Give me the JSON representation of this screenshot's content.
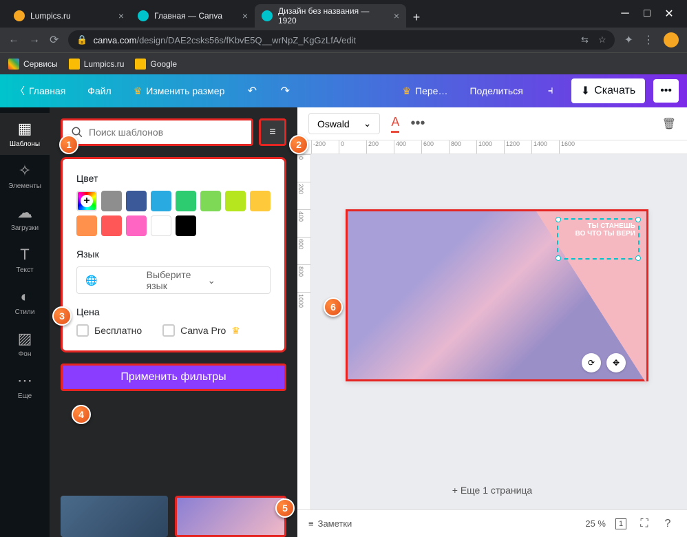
{
  "browser": {
    "tabs": [
      {
        "title": "Lumpics.ru",
        "active": false
      },
      {
        "title": "Главная — Canva",
        "active": false
      },
      {
        "title": "Дизайн без названия — 1920",
        "active": true
      }
    ],
    "url_prefix": "canva.com",
    "url_rest": "/design/DAE2csks56s/fKbvE5Q__wrNpZ_KgGzLfA/edit",
    "bookmarks": [
      "Сервисы",
      "Lumpics.ru",
      "Google"
    ]
  },
  "header": {
    "home": "Главная",
    "file": "Файл",
    "resize": "Изменить размер",
    "translate": "Пере…",
    "share": "Поделиться",
    "download": "Скачать"
  },
  "sidebar": {
    "items": [
      {
        "label": "Шаблоны",
        "active": true
      },
      {
        "label": "Элементы",
        "active": false
      },
      {
        "label": "Загрузки",
        "active": false
      },
      {
        "label": "Текст",
        "active": false
      },
      {
        "label": "Стили",
        "active": false
      },
      {
        "label": "Фон",
        "active": false
      },
      {
        "label": "Еще",
        "active": false
      }
    ]
  },
  "panel": {
    "search_placeholder": "Поиск шаблонов",
    "color_label": "Цвет",
    "colors": [
      "#8e8e8e",
      "#3b5998",
      "#29abe2",
      "#2ecc71",
      "#7ed957",
      "#b6e61d",
      "#ffc93c",
      "#ff914d",
      "#ff5757",
      "#ff66c4",
      "#ffffff",
      "#000000"
    ],
    "lang_label": "Язык",
    "lang_placeholder": "Выберите язык",
    "price_label": "Цена",
    "free": "Бесплатно",
    "pro": "Canva Pro",
    "apply": "Применить фильтры"
  },
  "context": {
    "font": "Oswald"
  },
  "canvas": {
    "text1": "ТЫ СТАНЕШЬ",
    "text2": "ВО ЧТО ТЫ ВЕРИ",
    "add_page": "+ Еще 1 страница",
    "ruler_h": [
      "-200",
      "0",
      "200",
      "400",
      "600",
      "800",
      "1000",
      "1200",
      "1400",
      "1600"
    ],
    "ruler_v": [
      "0",
      "200",
      "400",
      "600",
      "800",
      "1000"
    ]
  },
  "bottom": {
    "notes": "Заметки",
    "zoom": "25 %",
    "page": "1"
  },
  "markers": [
    "1",
    "2",
    "3",
    "4",
    "5",
    "6"
  ]
}
